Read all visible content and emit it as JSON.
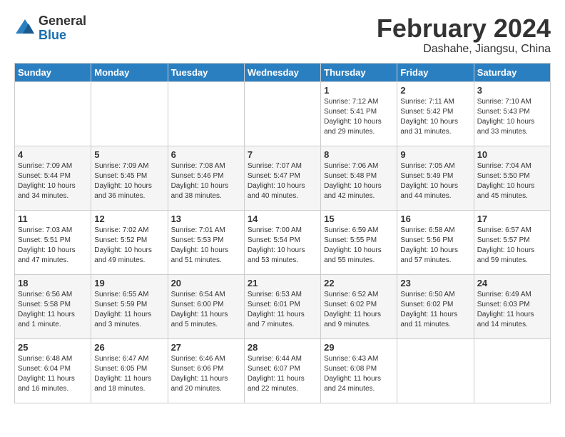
{
  "header": {
    "logo_general": "General",
    "logo_blue": "Blue",
    "month_title": "February 2024",
    "subtitle": "Dashahe, Jiangsu, China"
  },
  "weekdays": [
    "Sunday",
    "Monday",
    "Tuesday",
    "Wednesday",
    "Thursday",
    "Friday",
    "Saturday"
  ],
  "weeks": [
    [
      {
        "day": "",
        "info": ""
      },
      {
        "day": "",
        "info": ""
      },
      {
        "day": "",
        "info": ""
      },
      {
        "day": "",
        "info": ""
      },
      {
        "day": "1",
        "info": "Sunrise: 7:12 AM\nSunset: 5:41 PM\nDaylight: 10 hours\nand 29 minutes."
      },
      {
        "day": "2",
        "info": "Sunrise: 7:11 AM\nSunset: 5:42 PM\nDaylight: 10 hours\nand 31 minutes."
      },
      {
        "day": "3",
        "info": "Sunrise: 7:10 AM\nSunset: 5:43 PM\nDaylight: 10 hours\nand 33 minutes."
      }
    ],
    [
      {
        "day": "4",
        "info": "Sunrise: 7:09 AM\nSunset: 5:44 PM\nDaylight: 10 hours\nand 34 minutes."
      },
      {
        "day": "5",
        "info": "Sunrise: 7:09 AM\nSunset: 5:45 PM\nDaylight: 10 hours\nand 36 minutes."
      },
      {
        "day": "6",
        "info": "Sunrise: 7:08 AM\nSunset: 5:46 PM\nDaylight: 10 hours\nand 38 minutes."
      },
      {
        "day": "7",
        "info": "Sunrise: 7:07 AM\nSunset: 5:47 PM\nDaylight: 10 hours\nand 40 minutes."
      },
      {
        "day": "8",
        "info": "Sunrise: 7:06 AM\nSunset: 5:48 PM\nDaylight: 10 hours\nand 42 minutes."
      },
      {
        "day": "9",
        "info": "Sunrise: 7:05 AM\nSunset: 5:49 PM\nDaylight: 10 hours\nand 44 minutes."
      },
      {
        "day": "10",
        "info": "Sunrise: 7:04 AM\nSunset: 5:50 PM\nDaylight: 10 hours\nand 45 minutes."
      }
    ],
    [
      {
        "day": "11",
        "info": "Sunrise: 7:03 AM\nSunset: 5:51 PM\nDaylight: 10 hours\nand 47 minutes."
      },
      {
        "day": "12",
        "info": "Sunrise: 7:02 AM\nSunset: 5:52 PM\nDaylight: 10 hours\nand 49 minutes."
      },
      {
        "day": "13",
        "info": "Sunrise: 7:01 AM\nSunset: 5:53 PM\nDaylight: 10 hours\nand 51 minutes."
      },
      {
        "day": "14",
        "info": "Sunrise: 7:00 AM\nSunset: 5:54 PM\nDaylight: 10 hours\nand 53 minutes."
      },
      {
        "day": "15",
        "info": "Sunrise: 6:59 AM\nSunset: 5:55 PM\nDaylight: 10 hours\nand 55 minutes."
      },
      {
        "day": "16",
        "info": "Sunrise: 6:58 AM\nSunset: 5:56 PM\nDaylight: 10 hours\nand 57 minutes."
      },
      {
        "day": "17",
        "info": "Sunrise: 6:57 AM\nSunset: 5:57 PM\nDaylight: 10 hours\nand 59 minutes."
      }
    ],
    [
      {
        "day": "18",
        "info": "Sunrise: 6:56 AM\nSunset: 5:58 PM\nDaylight: 11 hours\nand 1 minute."
      },
      {
        "day": "19",
        "info": "Sunrise: 6:55 AM\nSunset: 5:59 PM\nDaylight: 11 hours\nand 3 minutes."
      },
      {
        "day": "20",
        "info": "Sunrise: 6:54 AM\nSunset: 6:00 PM\nDaylight: 11 hours\nand 5 minutes."
      },
      {
        "day": "21",
        "info": "Sunrise: 6:53 AM\nSunset: 6:01 PM\nDaylight: 11 hours\nand 7 minutes."
      },
      {
        "day": "22",
        "info": "Sunrise: 6:52 AM\nSunset: 6:02 PM\nDaylight: 11 hours\nand 9 minutes."
      },
      {
        "day": "23",
        "info": "Sunrise: 6:50 AM\nSunset: 6:02 PM\nDaylight: 11 hours\nand 11 minutes."
      },
      {
        "day": "24",
        "info": "Sunrise: 6:49 AM\nSunset: 6:03 PM\nDaylight: 11 hours\nand 14 minutes."
      }
    ],
    [
      {
        "day": "25",
        "info": "Sunrise: 6:48 AM\nSunset: 6:04 PM\nDaylight: 11 hours\nand 16 minutes."
      },
      {
        "day": "26",
        "info": "Sunrise: 6:47 AM\nSunset: 6:05 PM\nDaylight: 11 hours\nand 18 minutes."
      },
      {
        "day": "27",
        "info": "Sunrise: 6:46 AM\nSunset: 6:06 PM\nDaylight: 11 hours\nand 20 minutes."
      },
      {
        "day": "28",
        "info": "Sunrise: 6:44 AM\nSunset: 6:07 PM\nDaylight: 11 hours\nand 22 minutes."
      },
      {
        "day": "29",
        "info": "Sunrise: 6:43 AM\nSunset: 6:08 PM\nDaylight: 11 hours\nand 24 minutes."
      },
      {
        "day": "",
        "info": ""
      },
      {
        "day": "",
        "info": ""
      }
    ]
  ]
}
